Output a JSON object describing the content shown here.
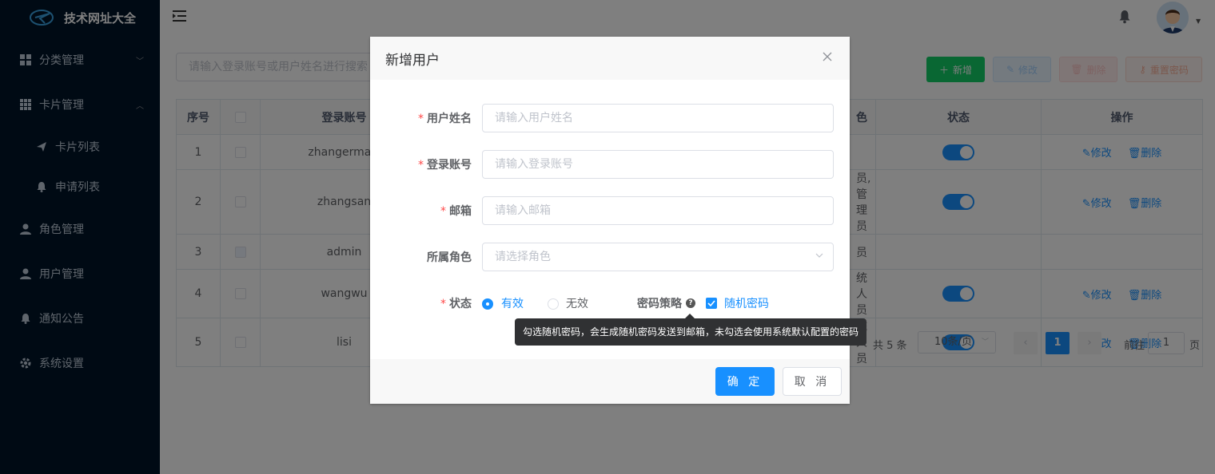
{
  "sidebar": {
    "logo_title": "技术网址大全",
    "items": [
      {
        "label": "分类管理",
        "icon": "grid-icon"
      },
      {
        "label": "卡片管理",
        "icon": "grid-icon"
      },
      {
        "label": "卡片列表",
        "icon": "send-icon"
      },
      {
        "label": "申请列表",
        "icon": "bell-icon"
      },
      {
        "label": "角色管理",
        "icon": "user-icon"
      },
      {
        "label": "用户管理",
        "icon": "user-icon"
      },
      {
        "label": "通知公告",
        "icon": "bell-icon"
      },
      {
        "label": "系统设置",
        "icon": "gear-icon"
      }
    ]
  },
  "toolbar": {
    "search_placeholder": "请输入登录账号或用户姓名进行搜索",
    "add_label": "新增",
    "edit_label": "修改",
    "delete_label": "删除",
    "reset_label": "重置密码"
  },
  "table": {
    "columns": [
      "序号",
      "登录账号",
      "状态",
      "操作"
    ],
    "partial_col_header": "色",
    "rows": [
      {
        "index": "1",
        "account": "zhangermazi",
        "role": "",
        "status": true
      },
      {
        "index": "2",
        "account": "zhangsan",
        "role": "员,管理员",
        "status": true
      },
      {
        "index": "3",
        "account": "admin",
        "role": "员",
        "status": null
      },
      {
        "index": "4",
        "account": "wangwu",
        "role": "统人员",
        "status": true
      },
      {
        "index": "5",
        "account": "lisi",
        "role": "统人员",
        "status": true
      }
    ],
    "edit_link": "修改",
    "delete_link": "删除"
  },
  "pagination": {
    "total": "共 5 条",
    "page_size": "10条/页",
    "current_page": "1",
    "goto_label": "前往",
    "goto_value": "1",
    "page_suffix": "页"
  },
  "dialog": {
    "title": "新增用户",
    "fields": {
      "name_label": "用户姓名",
      "name_placeholder": "请输入用户姓名",
      "account_label": "登录账号",
      "account_placeholder": "请输入登录账号",
      "email_label": "邮箱",
      "email_placeholder": "请输入邮箱",
      "role_label": "所属角色",
      "role_placeholder": "请选择角色",
      "status_label": "状态",
      "status_valid": "有效",
      "status_invalid": "无效",
      "policy_label": "密码策略",
      "random_password": "随机密码"
    },
    "tooltip": "勾选随机密码，会生成随机密码发送到邮箱，未勾选会使用系统默认配置的密码",
    "ok_label": "确 定",
    "cancel_label": "取 消"
  },
  "colors": {
    "primary": "#1890ff",
    "sidebar_bg": "#001529",
    "success": "#13ce66",
    "danger": "#ff4949"
  }
}
